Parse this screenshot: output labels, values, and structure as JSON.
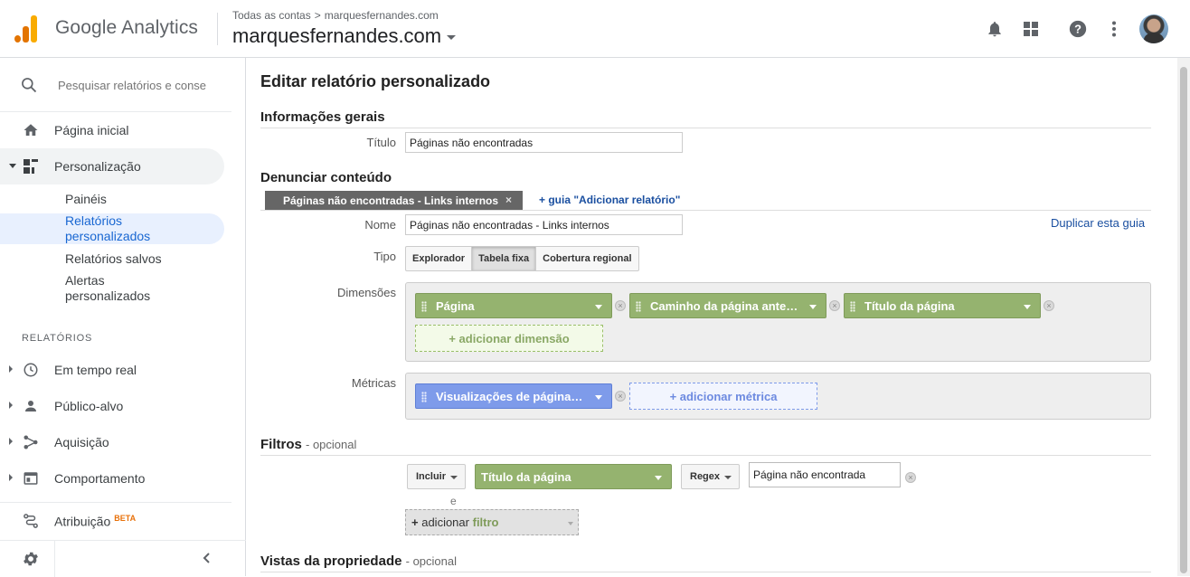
{
  "header": {
    "app_name": "Google Analytics",
    "breadcrumb_root": "Todas as contas",
    "breadcrumb_sep": ">",
    "breadcrumb_account": "marquesfernandes.com",
    "account_name": "marquesfernandes.com"
  },
  "sidebar": {
    "search_placeholder": "Pesquisar relatórios e conse",
    "home": "Página inicial",
    "customization": "Personalização",
    "sub_items": [
      "Painéis",
      "Relatórios\npersonalizados",
      "Relatórios salvos",
      "Alertas\npersonalizados"
    ],
    "sub_items_lines": [
      [
        "Painéis"
      ],
      [
        "Relatórios",
        "personalizados"
      ],
      [
        "Relatórios salvos"
      ],
      [
        "Alertas",
        "personalizados"
      ]
    ],
    "reports_label": "RELATÓRIOS",
    "items": [
      "Em tempo real",
      "Público-alvo",
      "Aquisição",
      "Comportamento",
      "Atribuição"
    ],
    "beta": "BETA"
  },
  "main": {
    "page_title": "Editar relatório personalizado",
    "general_info": "Informações gerais",
    "title_label": "Título",
    "title_value": "Páginas não encontradas",
    "content_section": "Denunciar conteúdo",
    "tab_label": "Páginas não encontradas - Links internos",
    "tab_close": "×",
    "add_tab": "+ guia \"Adicionar relatório\"",
    "duplicate_tab": "Duplicar esta guia",
    "name_label": "Nome",
    "name_value": "Páginas não encontradas - Links internos",
    "type_label": "Tipo",
    "type_options": [
      "Explorador",
      "Tabela fixa",
      "Cobertura regional"
    ],
    "type_selected": "Tabela fixa",
    "dimensions_label": "Dimensões",
    "dimensions": [
      "Página",
      "Caminho da página ante…",
      "Título da página"
    ],
    "add_dimension": "+ adicionar dimensão",
    "metrics_label": "Métricas",
    "metrics": [
      "Visualizações de página…"
    ],
    "add_metric": "+ adicionar métrica",
    "filters_section": "Filtros",
    "optional": "- opcional",
    "filter_mode": "Incluir",
    "filter_dimension": "Título da página",
    "filter_match": "Regex",
    "filter_value": "Página não encontrada",
    "and_label": "e",
    "add_filter_prefix": "+",
    "add_filter_verb": "adicionar",
    "add_filter_word": "filtro",
    "views_section": "Vistas da propriedade"
  },
  "colors": {
    "dimension_chip": "#95b36f",
    "metric_chip": "#7e9bea",
    "active_nav": "#1967d2",
    "link": "#1a4fa0"
  }
}
